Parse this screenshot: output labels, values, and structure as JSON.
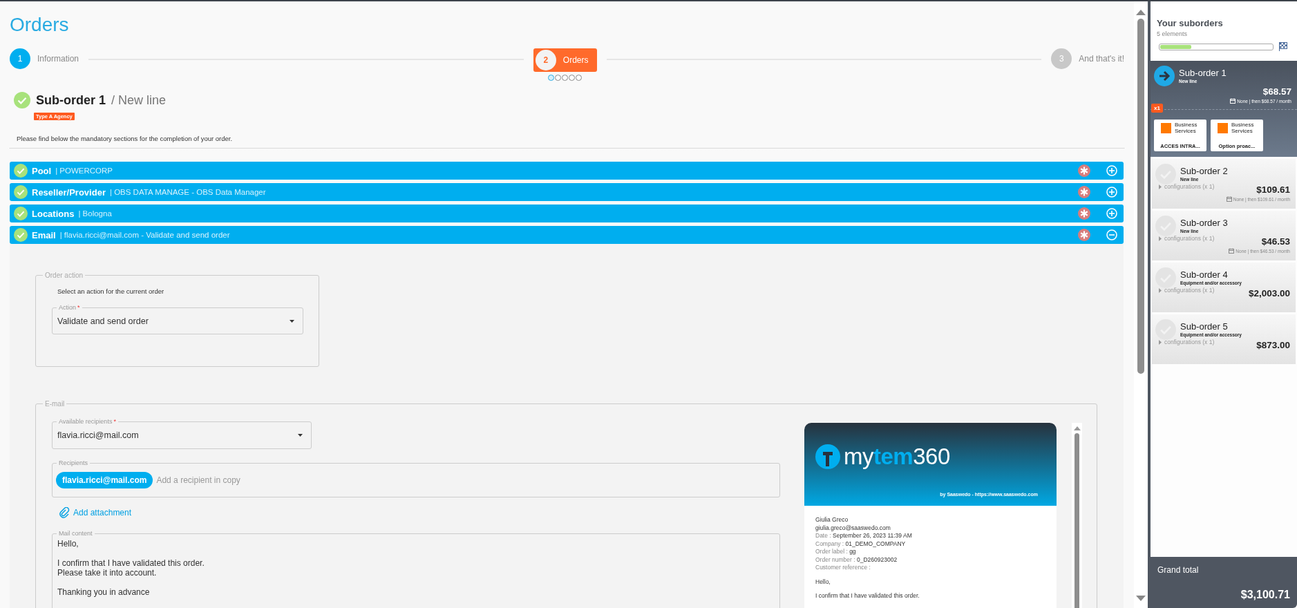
{
  "page": {
    "title": "Orders"
  },
  "stepper": {
    "steps": [
      {
        "number": "1",
        "label": "Information",
        "kind": "done"
      },
      {
        "number": "2",
        "label": "Orders",
        "kind": "current"
      },
      {
        "number": "3",
        "label": "And that's it!",
        "kind": "pending"
      }
    ],
    "dots": [
      {
        "selected": true
      },
      {
        "selected": false
      },
      {
        "selected": false
      },
      {
        "selected": false
      },
      {
        "selected": false
      }
    ]
  },
  "suborder": {
    "title": "Sub-order 1",
    "subtitle": "/ New line",
    "complete": true,
    "badge": "Type A Agency",
    "instructions": "Please find below the mandatory sections for the completion of your order."
  },
  "sections": [
    {
      "title": "Pool",
      "value": "| POWERCORP",
      "complete": true,
      "expanded": false
    },
    {
      "title": "Reseller/Provider",
      "value": "| OBS DATA MANAGE - OBS Data Manager",
      "complete": true,
      "expanded": false
    },
    {
      "title": "Locations",
      "value": "| Bologna",
      "complete": true,
      "expanded": false
    },
    {
      "title": "Email",
      "value": "| flavia.ricci@mail.com - Validate and send order",
      "complete": true,
      "expanded": true
    }
  ],
  "order_action": {
    "legend": "Order action",
    "prompt": "Select an action for the current order",
    "action_field": {
      "label": "Action",
      "required_mark": "*",
      "value": "Validate and send order"
    }
  },
  "email": {
    "legend": "E-mail",
    "recipients_select": {
      "label": "Available recipients",
      "required_mark": "*",
      "value": "flavia.ricci@mail.com"
    },
    "recipients": {
      "label": "Recipients",
      "chips": [
        "flavia.ricci@mail.com"
      ],
      "placeholder": "Add a recipient in copy"
    },
    "attachment_link": "Add attachment",
    "mail_content": {
      "label": "Mail content",
      "value": "Hello,\n\nI confirm that I have validated this order.\nPlease take it into account.\n\nThanking you in advance"
    },
    "preview": {
      "logo_parts": [
        {
          "text": "my",
          "accent": false
        },
        {
          "text": "tem",
          "accent": true
        },
        {
          "text": "360",
          "accent": false
        }
      ],
      "byline": "by Saaswedo - https://www.saaswedo.com",
      "sender": [
        "Giulia Greco",
        "giulia.greco@saaswedo.com"
      ],
      "fields": [
        {
          "label": "Date :",
          "value": "September 26, 2023 11:39 AM"
        },
        {
          "label": "Company :",
          "value": "01_DEMO_COMPANY"
        },
        {
          "label": "Order label :",
          "value": "gg"
        },
        {
          "label": "Order number :",
          "value": "0_D260923002"
        },
        {
          "label": "Customer reference :"
        }
      ],
      "body": [
        "Hello,",
        "I confirm that I have validated this order."
      ]
    }
  },
  "sidebar": {
    "title": "Your suborders",
    "count": "5 elements",
    "progress": {
      "level": 0.28
    },
    "suborders": [
      {
        "title": "Sub-order 1",
        "type": "New line",
        "selected": true,
        "price": "$68.57",
        "price_detail": "None | then $68.57 / month",
        "quantity_badge": "x1",
        "products": [
          {
            "logo_text": "Business Services",
            "name": "ACCES INTRA..."
          },
          {
            "logo_text": "Business Services",
            "name": "Option proac..."
          }
        ]
      },
      {
        "title": "Sub-order 2",
        "type": "New line",
        "selected": false,
        "configurations": "configurations (x 1)",
        "price": "$109.61",
        "price_detail": "None | then $109.61 / month"
      },
      {
        "title": "Sub-order 3",
        "type": "New line",
        "selected": false,
        "configurations": "configurations (x 1)",
        "price": "$46.53",
        "price_detail": "None | then $46.53 / month"
      },
      {
        "title": "Sub-order 4",
        "type": "Equipment and/or accessory",
        "selected": false,
        "configurations": "configurations (x 1)",
        "price": "$2,003.00"
      },
      {
        "title": "Sub-order 5",
        "type": "Equipment and/or accessory",
        "selected": false,
        "configurations": "configurations (x 1)",
        "price": "$873.00"
      }
    ],
    "grand_total": {
      "label": "Grand total",
      "value": "$3,100.71"
    }
  }
}
